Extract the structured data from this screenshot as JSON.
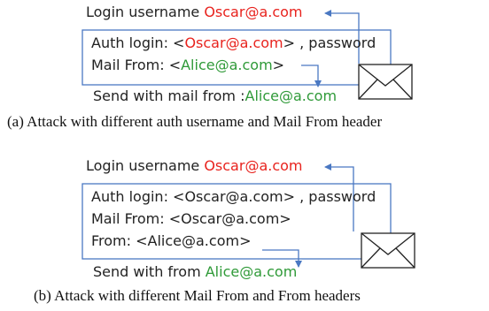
{
  "diagram_a": {
    "login_label": "Login username ",
    "login_user": "Oscar@a.com",
    "line1": "Auth login: <",
    "line1_user": "Oscar@a.com",
    "line1_tail": "> , password",
    "line2": "Mail From: <",
    "line2_user": "Alice@a.com",
    "line2_tail": ">",
    "send_label": "Send with mail from :",
    "send_user": "Alice@a.com",
    "caption": "(a)  Attack with different auth username and Mail From header"
  },
  "diagram_b": {
    "login_label": "Login username  ",
    "login_user": "Oscar@a.com",
    "line1": "Auth login: <Oscar@a.com> , password",
    "line2": "Mail From: <Oscar@a.com>",
    "line3": "From: <Alice@a.com>",
    "send_label": "Send with from ",
    "send_user": "Alice@a.com",
    "caption": "(b)  Attack with different Mail From and From headers"
  },
  "colors": {
    "frame": "#4a78c2",
    "attacker": "#e8231e",
    "spoofed": "#2f9a38"
  }
}
